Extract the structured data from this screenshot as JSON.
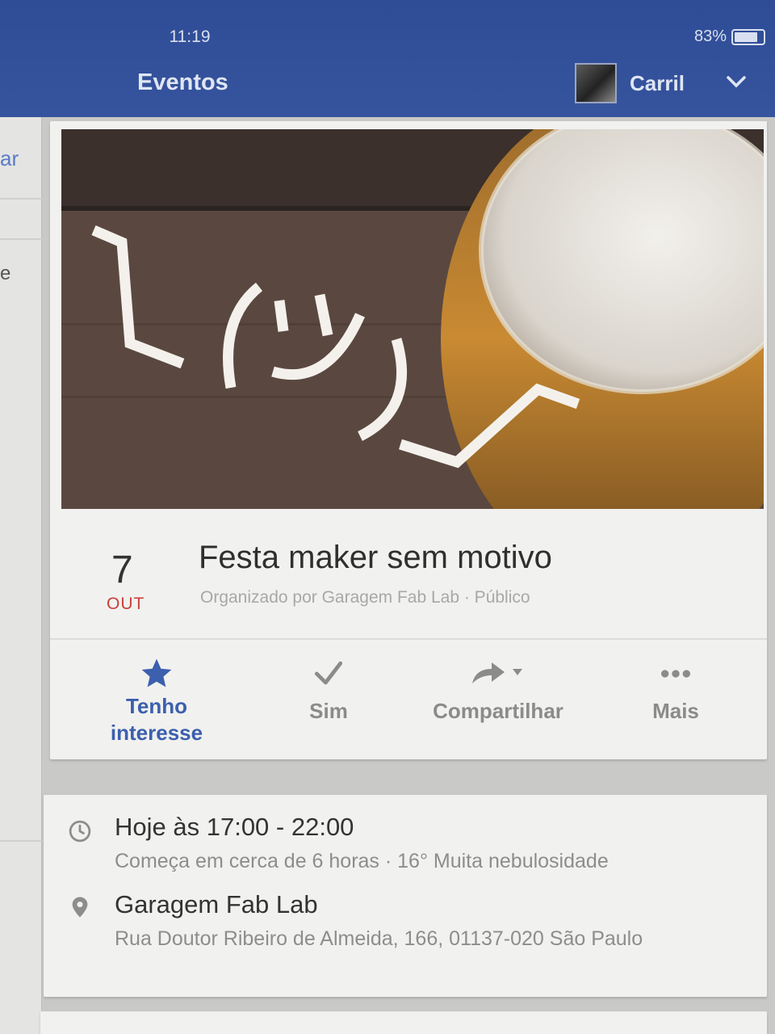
{
  "status": {
    "time": "11:19",
    "battery": "83%",
    "battery_level": 0.83
  },
  "header": {
    "title": "Eventos",
    "user_name": "Carril"
  },
  "left_panel": {
    "link_fragment": "ar",
    "text_fragment": "e"
  },
  "event": {
    "cover_text": "¯\\_(ツ)_/¯",
    "date_day": "7",
    "date_month": "OUT",
    "title": "Festa maker sem motivo",
    "subtitle": "Organizado por Garagem Fab Lab · Público"
  },
  "actions": [
    {
      "label": "Tenho interesse",
      "icon": "star-icon",
      "active": true
    },
    {
      "label": "Sim",
      "icon": "check-icon",
      "active": false
    },
    {
      "label": "Compartilhar",
      "icon": "share-icon",
      "active": false
    },
    {
      "label": "Mais",
      "icon": "more-icon",
      "active": false
    }
  ],
  "details": {
    "time": "Hoje às 17:00 - 22:00",
    "time_sub": "Começa em cerca de 6 horas · 16° Muita nebulosidade",
    "place": "Garagem Fab Lab",
    "address": "Rua Doutor Ribeiro de Almeida, 166, 01137-020 São Paulo"
  },
  "colors": {
    "header": "#36549e",
    "accent": "#3c5fae",
    "month": "#c9403a"
  }
}
